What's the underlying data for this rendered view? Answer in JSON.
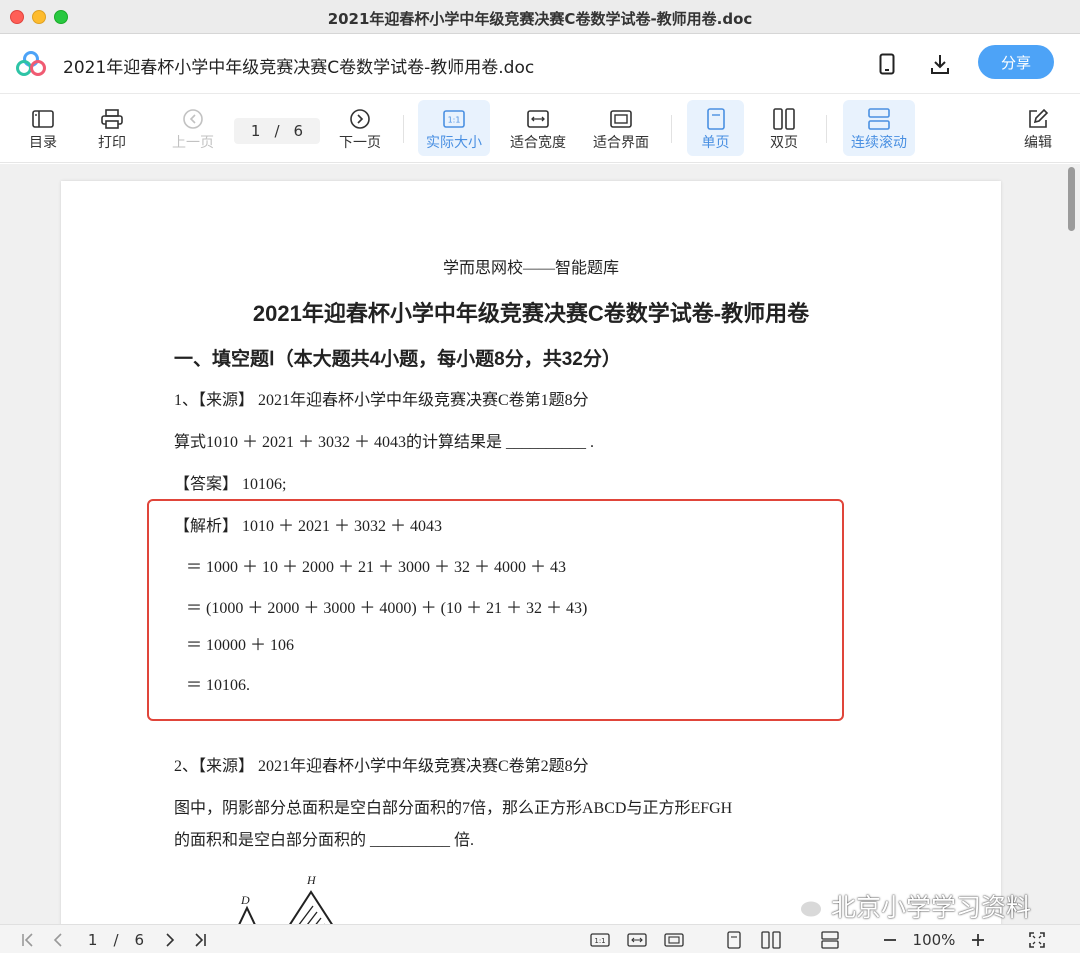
{
  "window": {
    "title": "2021年迎春杯小学中年级竞赛决赛C卷数学试卷-教师用卷.doc"
  },
  "header": {
    "doc_title": "2021年迎春杯小学中年级竞赛决赛C卷数学试卷-教师用卷.doc",
    "share_label": "分享",
    "icons": [
      "logo-icon",
      "phone-icon",
      "download-icon"
    ]
  },
  "toolbar": {
    "toc": "目录",
    "print": "打印",
    "prev": "上一页",
    "page_current": "1",
    "page_sep": "/",
    "page_total": "6",
    "next": "下一页",
    "actual_size": "实际大小",
    "fit_width": "适合宽度",
    "fit_screen": "适合界面",
    "single_page": "单页",
    "double_page": "双页",
    "continuous": "连续滚动",
    "edit": "编辑"
  },
  "document": {
    "subheading": "学而思网校——智能题库",
    "title": "2021年迎春杯小学中年级竞赛决赛C卷数学试卷-教师用卷",
    "section": "一、填空题Ⅰ（本大题共4小题，每小题8分，共32分）",
    "q1_source": "1、【来源】 2021年迎春杯小学中年级竞赛决赛C卷第1题8分",
    "q1_text": "算式1010 ＋ 2021 ＋ 3032 ＋ 4043的计算结果是 __________ .",
    "q1_answer": "【答案】 10106;",
    "q1_solution": [
      "【解析】 1010 ＋ 2021 ＋ 3032 ＋ 4043",
      "＝ 1000 ＋ 10 ＋ 2000 ＋ 21 ＋ 3000 ＋ 32 ＋ 4000 ＋ 43",
      "＝ (1000 ＋ 2000 ＋ 3000 ＋ 4000) ＋ (10 ＋ 21 ＋ 32 ＋ 43)",
      "＝ 10000 ＋ 106",
      "＝ 10106."
    ],
    "q2_source": "2、【来源】 2021年迎春杯小学中年级竞赛决赛C卷第2题8分",
    "q2_text_1": "图中，阴影部分总面积是空白部分面积的7倍，那么正方形ABCD与正方形EFGH",
    "q2_text_2": "的面积和是空白部分面积的 __________ 倍.",
    "figure_labels": {
      "d": "D",
      "h": "H"
    }
  },
  "bottombar": {
    "page_current": "1",
    "page_sep": "/",
    "page_total": "6",
    "zoom": "100%"
  },
  "watermark": "北京小学学习资料",
  "colors": {
    "accent": "#4da3f7",
    "highlight_border": "#e0453a",
    "active_bg": "#e8f2fd"
  }
}
